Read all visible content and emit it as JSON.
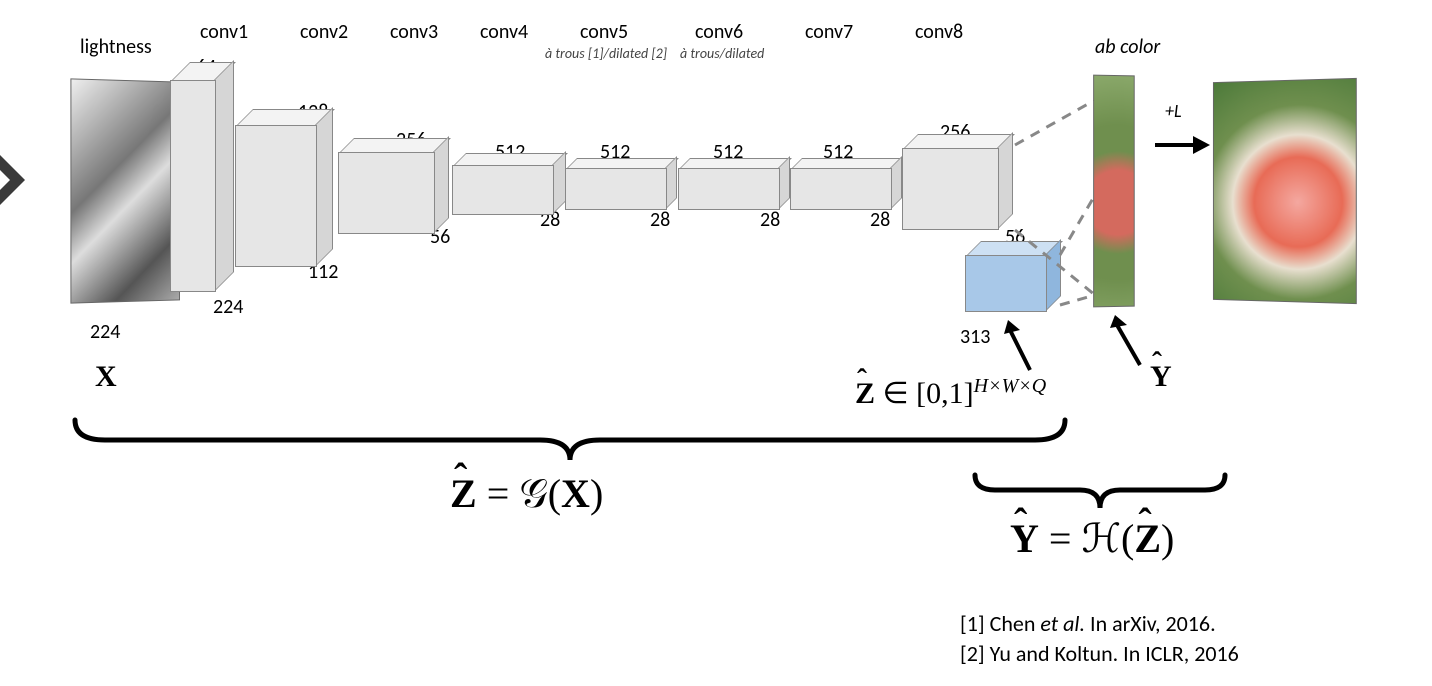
{
  "input_label": "lightness",
  "output_label": "ab color",
  "plus_L": "+L",
  "layers": [
    {
      "name": "conv1",
      "sub": "",
      "channels": 64,
      "spatial": 224
    },
    {
      "name": "conv2",
      "sub": "",
      "channels": 128,
      "spatial": 224
    },
    {
      "name": "conv3",
      "sub": "",
      "channels": 256,
      "spatial": 112
    },
    {
      "name": "conv4",
      "sub": "",
      "channels": 512,
      "spatial": 56
    },
    {
      "name": "conv5",
      "sub": "à trous [1]/dilated [2]",
      "channels": 512,
      "spatial": 28
    },
    {
      "name": "conv6",
      "sub": "à trous/dilated",
      "channels": 512,
      "spatial": 28
    },
    {
      "name": "conv7",
      "sub": "",
      "channels": 512,
      "spatial": 28
    },
    {
      "name": "conv8",
      "sub": "",
      "channels": 256,
      "spatial": 28
    }
  ],
  "conv8_spatial_label": "56",
  "input_spatial": "224",
  "z_block": {
    "channels": "313"
  },
  "symbols": {
    "X": "X",
    "Zhat_dim": "𝐙̂ ∈ [0,1]ᴴˣᵂˣQ",
    "Yhat": "Ŷ",
    "eq1": "𝐙̂ = 𝒢(X)",
    "eq2": "Ŷ = ℋ(𝐙̂)"
  },
  "references": [
    "[1] Chen et al. In arXiv, 2016.",
    "[2] Yu and Koltun. In ICLR, 2016"
  ]
}
